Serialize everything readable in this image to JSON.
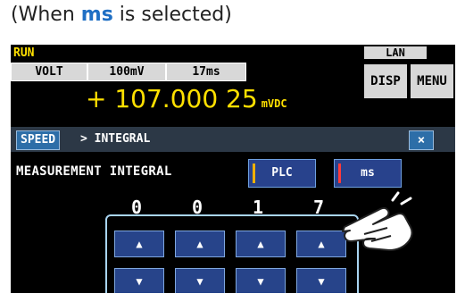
{
  "caption": {
    "prefix": "(When ",
    "highlight": "ms",
    "suffix": " is selected)"
  },
  "status": {
    "run": "RUN",
    "lan": "LAN"
  },
  "header": {
    "function": "VOLT",
    "range": "100mV",
    "speed": "17ms"
  },
  "measurement": {
    "value": "+ 107.000 25",
    "unit": "mVDC"
  },
  "side_buttons": {
    "disp": "DISP",
    "menu": "MENU"
  },
  "breadcrumb": {
    "parent": "SPEED",
    "separator": ">",
    "current": "INTEGRAL",
    "close": "×"
  },
  "integral": {
    "label": "MEASUREMENT INTEGRAL",
    "options": [
      "PLC",
      "ms"
    ],
    "selected": "ms",
    "digits": [
      "0",
      "0",
      "1",
      "7"
    ],
    "unit": "ms",
    "up_symbol": "▲",
    "down_symbol": "▼"
  },
  "colors": {
    "caption_highlight": "#1f6fc4",
    "screen_bg": "#000000",
    "value_yellow": "#ffe000",
    "button_blue": "#28428c",
    "navbar": "#2c3846",
    "frame": "#a9d5f2"
  },
  "icons": [
    "close-icon",
    "pointing-hand-icon",
    "arrow-up-icon",
    "arrow-down-icon"
  ]
}
